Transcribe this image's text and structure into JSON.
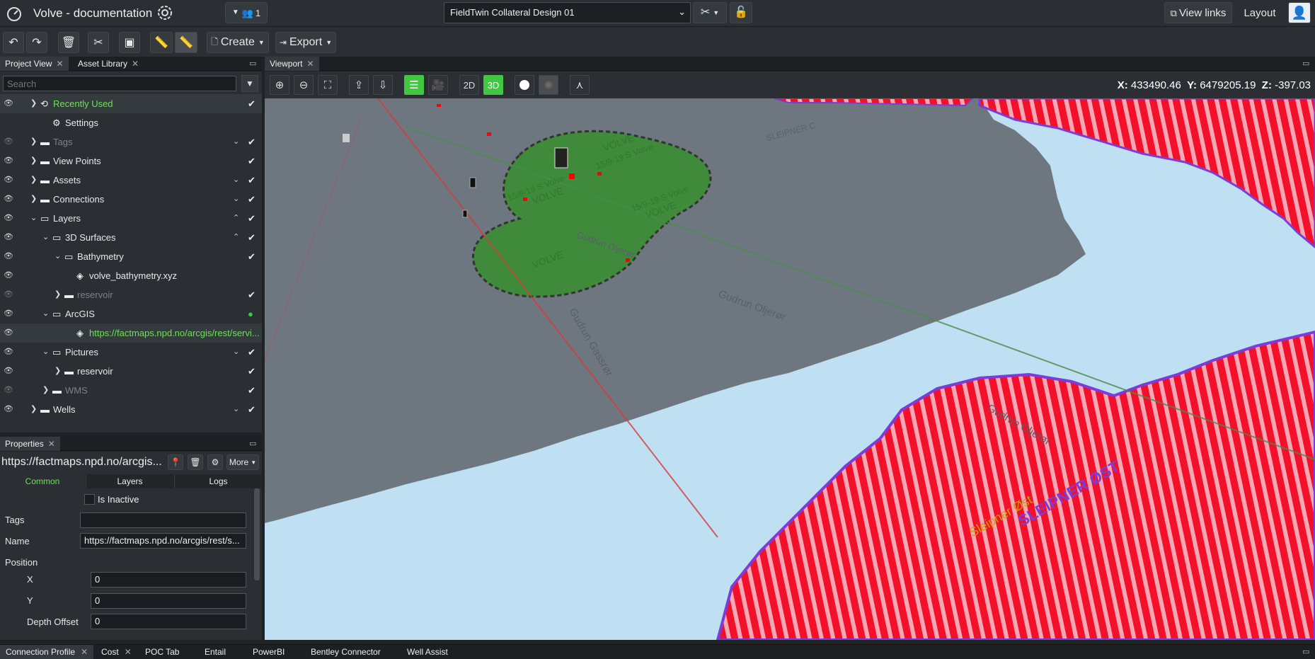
{
  "app": {
    "title": "Volve - documentation",
    "users_count": "1",
    "design_select": "FieldTwin Collateral Design 01",
    "view_links": "View links",
    "layout": "Layout"
  },
  "toolbar": {
    "create": "Create",
    "export": "Export"
  },
  "left_tabs": {
    "project_view": "Project View",
    "asset_library": "Asset Library"
  },
  "search": {
    "placeholder": "Search"
  },
  "tree": [
    {
      "label": "Recently Used",
      "green": true,
      "highlight": true
    },
    {
      "label": "Settings"
    },
    {
      "label": "Tags",
      "dim": true
    },
    {
      "label": "View Points"
    },
    {
      "label": "Assets"
    },
    {
      "label": "Connections"
    },
    {
      "label": "Layers"
    },
    {
      "label": "3D Surfaces"
    },
    {
      "label": "Bathymetry"
    },
    {
      "label": "volve_bathymetry.xyz"
    },
    {
      "label": "reservoir",
      "dim": true
    },
    {
      "label": "ArcGIS"
    },
    {
      "label": "https://factmaps.npd.no/arcgis/rest/servi...",
      "green": true,
      "highlight": true
    },
    {
      "label": "Pictures"
    },
    {
      "label": "reservoir"
    },
    {
      "label": "WMS",
      "dim": true
    },
    {
      "label": "Wells"
    }
  ],
  "properties": {
    "tab": "Properties",
    "title": "https://factmaps.npd.no/arcgis...",
    "more": "More",
    "subtabs": [
      "Common",
      "Layers",
      "Logs"
    ],
    "is_inactive": "Is Inactive",
    "tags_label": "Tags",
    "tags_value": "",
    "name_label": "Name",
    "name_value": "https://factmaps.npd.no/arcgis/rest/s...",
    "position_label": "Position",
    "x_label": "X",
    "x_value": "0",
    "y_label": "Y",
    "y_value": "0",
    "depth_label": "Depth Offset",
    "depth_value": "0"
  },
  "viewport": {
    "tab": "Viewport",
    "mode_2d": "2D",
    "mode_3d": "3D",
    "coord_x": "433490.46",
    "coord_y": "6479205.19",
    "coord_z": "-397.03",
    "x_prefix": "X:",
    "y_prefix": "Y:",
    "z_prefix": "Z:",
    "map_labels": {
      "volve": "VOLVE",
      "gudrun_olje": "Gudrun Oljerør",
      "gudrun_gas": "Gudrun Gassrør",
      "sleipner_c": "SLEIPNER C",
      "sleipner_ost_label": "Sleipner Øst",
      "sleipner_ost_big": "SLEIPNER ØST",
      "field_1": "15/9-19 S Volve",
      "field_2": "15/9-19 S Volve",
      "field_3": "15/9-19 S Volve"
    }
  },
  "bottom_tabs": [
    "Connection Profile",
    "Cost",
    "POC Tab",
    "Entail",
    "PowerBI",
    "Bentley Connector",
    "Well Assist"
  ],
  "colors": {
    "accent": "#42c742",
    "green_text": "#6fe05a",
    "seabed": "#6e7780",
    "water": "#bfe0f2",
    "field": "#3f8b3b",
    "hatch_red": "#f2102a"
  }
}
